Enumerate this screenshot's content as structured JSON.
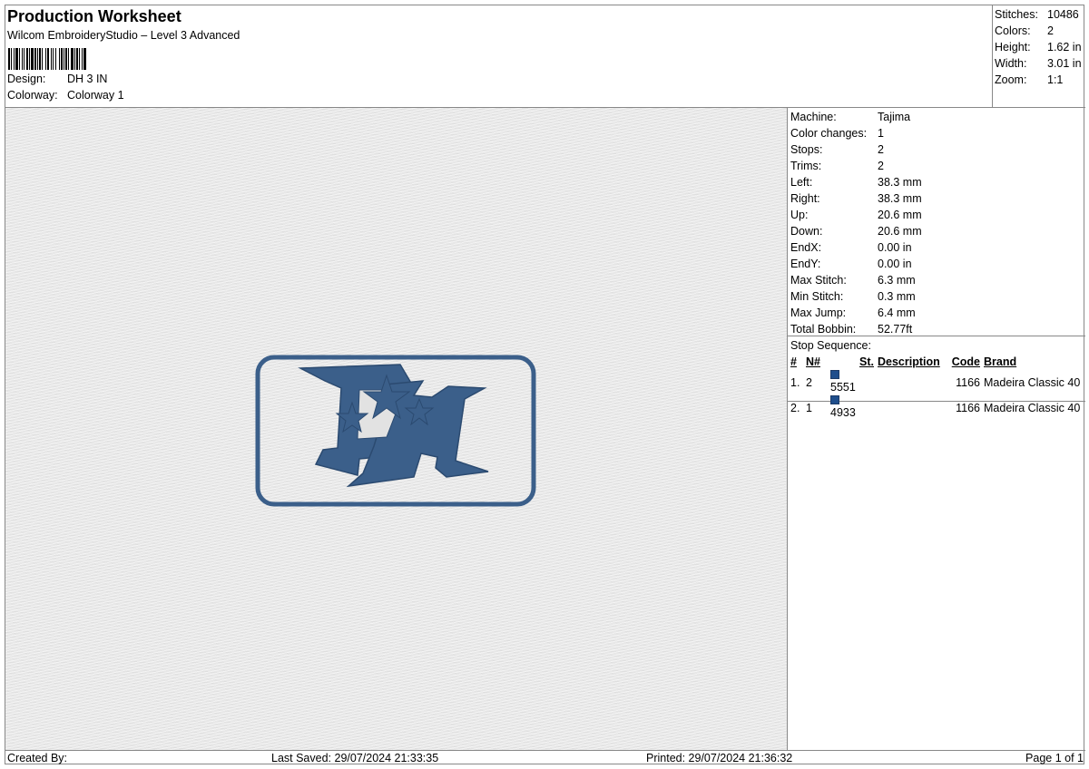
{
  "header": {
    "title": "Production Worksheet",
    "software": "Wilcom EmbroideryStudio – Level 3 Advanced",
    "barcode_icon": "barcode-icon",
    "design_label": "Design:",
    "design_value": "DH 3 IN",
    "colorway_label": "Colorway:",
    "colorway_value": "Colorway 1"
  },
  "summary": [
    {
      "label": "Stitches:",
      "value": "10486"
    },
    {
      "label": "Colors:",
      "value": "2"
    },
    {
      "label": "Height:",
      "value": "1.62 in"
    },
    {
      "label": "Width:",
      "value": "3.01 in"
    },
    {
      "label": "Zoom:",
      "value": "1:1"
    }
  ],
  "machine": [
    {
      "label": "Machine:",
      "value": "Tajima"
    },
    {
      "label": "Color changes:",
      "value": "1"
    },
    {
      "label": "Stops:",
      "value": "2"
    },
    {
      "label": "Trims:",
      "value": "2"
    },
    {
      "label": "Left:",
      "value": "38.3 mm"
    },
    {
      "label": "Right:",
      "value": "38.3 mm"
    },
    {
      "label": "Up:",
      "value": "20.6 mm"
    },
    {
      "label": "Down:",
      "value": "20.6 mm"
    },
    {
      "label": "EndX:",
      "value": "0.00 in"
    },
    {
      "label": "EndY:",
      "value": "0.00 in"
    },
    {
      "label": "Max Stitch:",
      "value": "6.3 mm"
    },
    {
      "label": "Min Stitch:",
      "value": "0.3 mm"
    },
    {
      "label": "Max Jump:",
      "value": "6.4 mm"
    },
    {
      "label": "Total Bobbin:",
      "value": "52.77ft"
    }
  ],
  "stop_sequence": {
    "title": "Stop Sequence:",
    "headers": {
      "num": "#",
      "n": "N#",
      "st": "St.",
      "description": "Description",
      "code": "Code",
      "brand": "Brand"
    },
    "rows": [
      {
        "num": "1.",
        "n": "2",
        "color": "#1f4e8c",
        "st": "5551",
        "description": "",
        "code": "1166",
        "brand": "Madeira Classic 40"
      },
      {
        "num": "2.",
        "n": "1",
        "color": "#1f4e8c",
        "st": "4933",
        "description": "",
        "code": "1166",
        "brand": "Madeira Classic 40"
      }
    ]
  },
  "design": {
    "thread_color": "#3b5f8a",
    "thread_dark": "#2b4a70"
  },
  "footer": {
    "created_by": "Created By:",
    "last_saved": "Last Saved: 29/07/2024 21:33:35",
    "printed": "Printed: 29/07/2024 21:36:32",
    "page": "Page 1 of 1"
  }
}
